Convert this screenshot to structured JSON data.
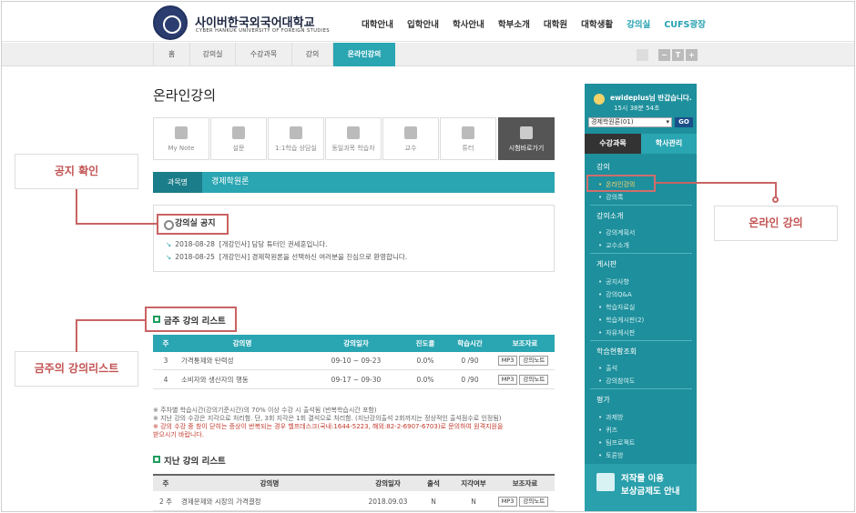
{
  "header": {
    "logo_korean": "사이버한국외국어대학교",
    "logo_english": "CYBER HANKUK UNIVERSITY OF FOREIGN STUDIES",
    "nav": [
      "대학안내",
      "입학안내",
      "학사안내",
      "학부소개",
      "대학원",
      "대학생활",
      "강의실",
      "CUFS광장"
    ],
    "nav_active": "강의실"
  },
  "subnav": {
    "tabs": [
      "홈",
      "강의실",
      "수강과목",
      "강의",
      "온라인강의"
    ],
    "active": "온라인강의",
    "tools": [
      "printer-icon",
      "−",
      "T",
      "+"
    ]
  },
  "page": {
    "title": "온라인강의",
    "icon_tabs": [
      {
        "label": "My Note",
        "icon": "notebook-icon"
      },
      {
        "label": "설문",
        "icon": "clipboard-icon"
      },
      {
        "label": "1:1학습 상담실",
        "icon": "chat-icon"
      },
      {
        "label": "동일과목 학습자",
        "icon": "list-icon"
      },
      {
        "label": "교수",
        "icon": "person-icon"
      },
      {
        "label": "튜터",
        "icon": "id-card-icon"
      },
      {
        "label": "시험바로가기",
        "icon": "pencil-icon"
      }
    ],
    "course_bar": {
      "label": "과목명",
      "course": "경제학원론"
    },
    "notice": {
      "title": "강의실 공지",
      "items": [
        {
          "date": "2018-08-28",
          "text": "[개강인사] 담당 튜터인 권세훈입니다."
        },
        {
          "date": "2018-08-25",
          "text": "[개강인사] 경제학원론을 선택하신 여러분을 진심으로 환영합니다."
        }
      ]
    },
    "this_week": {
      "title": "금주 강의 리스트",
      "columns": [
        "주",
        "강의명",
        "강의일자",
        "진도율",
        "학습시간",
        "보조자료"
      ],
      "rows": [
        {
          "week": "3",
          "name": "가격통제와 탄력성",
          "date": "09-10 ~ 09-23",
          "progress": "0.0%",
          "time": "0 /90",
          "b1": "MP3",
          "b2": "강의노트"
        },
        {
          "week": "4",
          "name": "소비자와 생산자의 행동",
          "date": "09-17 ~ 09-30",
          "progress": "0.0%",
          "time": "0 /90",
          "b1": "MP3",
          "b2": "강의노트"
        }
      ]
    },
    "notes": [
      "※ 주차별 학습시간(강의기준시간)의 70% 이상 수강 시 출석됨 (반복학습시간 포함)",
      "※ 지난 강의 수강은 지각으로 처리함. 단, 3회 지각은 1회 결석으로 처리함. (지난강의출석 2회까지는 정상적인 출석점수로 인정됨)",
      "※ 강의 수강 중 창이 닫히는 증상이 반복되는 경우 헬프데스크(국내:1644-5223, 해외:82-2-6907-6703)로 문의하여 원격지원을",
      "받으시기 바랍니다."
    ],
    "past": {
      "title": "지난 강의 리스트",
      "columns": [
        "주",
        "강의명",
        "강의일자",
        "출석",
        "지각여부",
        "보조자료"
      ],
      "rows": [
        {
          "week": "2 주",
          "name": "경제문제와 시장의 가격결정",
          "date": "2018.09.03",
          "attend": "N",
          "late": "N",
          "b1": "MP3",
          "b2": "강의노트"
        }
      ]
    }
  },
  "sidebar": {
    "user": "ewideplus님 반갑습니다.",
    "time": "15시 38분 54초",
    "select_value": "경제학원론(01)",
    "go": "GO",
    "tabs": [
      "수강과목",
      "학사관리"
    ],
    "menu": [
      {
        "cat": "강의",
        "items": [
          "온라인강의",
          "강의록"
        ]
      },
      {
        "cat": "강의소개",
        "items": [
          "강의계획서",
          "교수소개"
        ]
      },
      {
        "cat": "게시판",
        "items": [
          "공지사항",
          "강의Q&A",
          "학습자료실",
          "학습게시판(2)",
          "자유게시판"
        ]
      },
      {
        "cat": "학습현황조회",
        "items": [
          "출석",
          "강의참여도"
        ]
      },
      {
        "cat": "평가",
        "items": [
          "과제방",
          "퀴즈",
          "팀프로젝트",
          "토론방"
        ]
      }
    ],
    "active_item": "온라인강의",
    "banner": [
      "저작물 이용",
      "보상금제도 안내"
    ]
  },
  "callouts": {
    "notice": "공지 확인",
    "online": "온라인 강의",
    "weekly": "금주의 강의리스트"
  },
  "colors": {
    "teal": "#2aa5b2",
    "dark_teal": "#1e8f9c",
    "callout_red": "#c96363",
    "green": "#1e9d5c"
  }
}
